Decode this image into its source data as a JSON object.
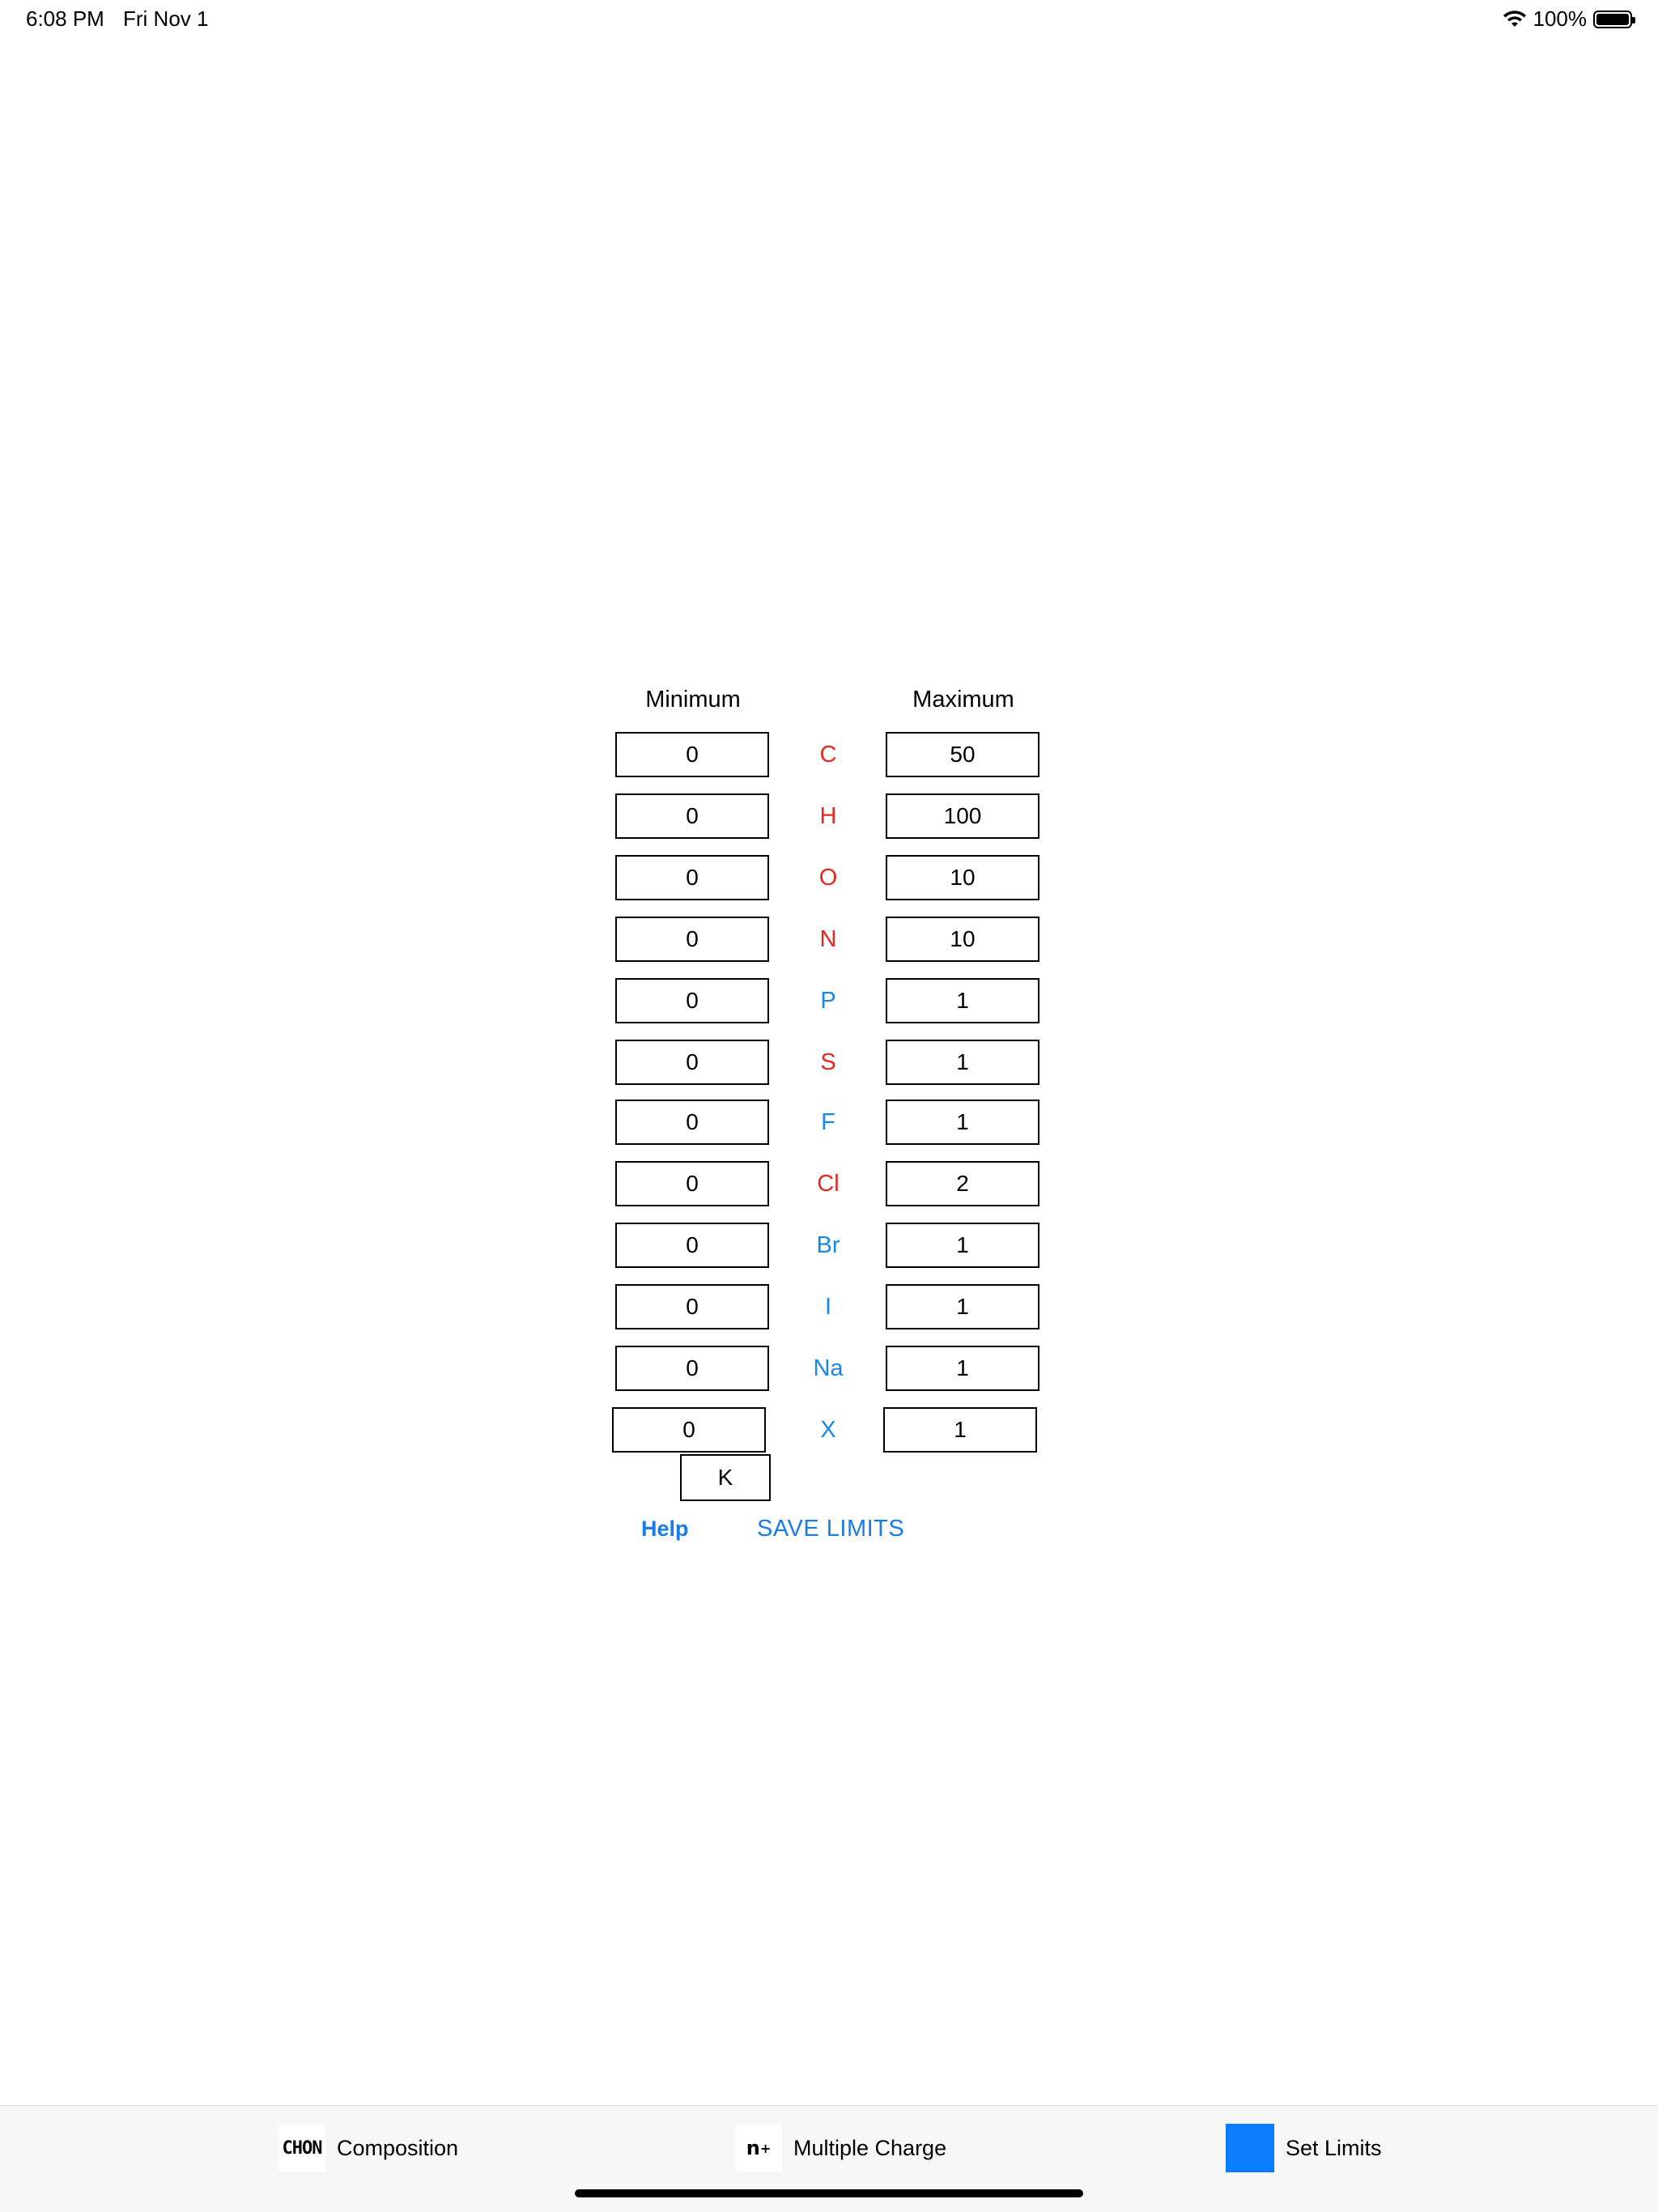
{
  "status_bar": {
    "time": "6:08 PM",
    "date": "Fri Nov 1",
    "battery": "100%"
  },
  "form": {
    "min_header": "Minimum",
    "max_header": "Maximum",
    "rows": [
      {
        "element": "C",
        "min": "0",
        "max": "50"
      },
      {
        "element": "H",
        "min": "0",
        "max": "100"
      },
      {
        "element": "O",
        "min": "0",
        "max": "10"
      },
      {
        "element": "N",
        "min": "0",
        "max": "10"
      },
      {
        "element": "P",
        "min": "0",
        "max": "1"
      },
      {
        "element": "S",
        "min": "0",
        "max": "1"
      },
      {
        "element": "F",
        "min": "0",
        "max": "1"
      },
      {
        "element": "Cl",
        "min": "0",
        "max": "2"
      },
      {
        "element": "Br",
        "min": "0",
        "max": "1"
      },
      {
        "element": "I",
        "min": "0",
        "max": "1"
      },
      {
        "element": "Na",
        "min": "0",
        "max": "1"
      },
      {
        "element": "X",
        "min": "0",
        "max": "1"
      }
    ],
    "extra_element": "K",
    "help_label": "Help",
    "save_label": "SAVE LIMITS"
  },
  "colors": {
    "red_label": "#e8281e",
    "blue_label": "#1a86e8",
    "link": "#1a7ce8",
    "active_tab": "#0a7cff"
  },
  "tabs": [
    {
      "label": "Composition",
      "icon": "chon-icon",
      "icon_text": "CHON"
    },
    {
      "label": "Multiple Charge",
      "icon": "charge-icon",
      "icon_text": "n+"
    },
    {
      "label": "Set Limits",
      "icon": "limits-icon"
    }
  ]
}
